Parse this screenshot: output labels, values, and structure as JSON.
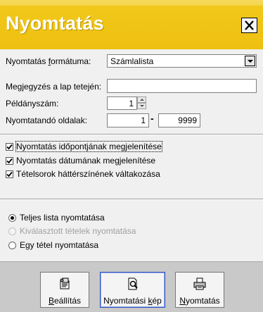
{
  "dialog": {
    "title": "Nyomtatás"
  },
  "form": {
    "format_label_pre": "Nyomtatás ",
    "format_label_u": "f",
    "format_label_post": "ormátuma:",
    "format_value": "Számlalista",
    "note_label": "Megjegyzés a lap tetején:",
    "note_value": "",
    "copies_label": "Példányszám:",
    "copies_value": "1",
    "pages_label": "Nyomtatandó oldalak:",
    "pages_from": "1",
    "pages_dash": "-",
    "pages_to": "9999"
  },
  "options": [
    {
      "label": "Nyomtatás időpontjának megjelenítése",
      "checked": true
    },
    {
      "label": "Nyomtatás dátumának megjelenítése",
      "checked": true
    },
    {
      "label": "Tételsorok háttérszínének váltakozása",
      "checked": true
    }
  ],
  "scope": [
    {
      "label": "Teljes lista nyomtatása",
      "selected": true,
      "enabled": true
    },
    {
      "label": "Kiválasztott tételek nyomtatása",
      "selected": false,
      "enabled": false
    },
    {
      "label": "Egy tétel nyomtatása",
      "selected": false,
      "enabled": true
    }
  ],
  "buttons": {
    "settings_u": "B",
    "settings_rest": "eállítás",
    "preview_pre": "Nyomtatási ",
    "preview_u": "k",
    "preview_post": "ép",
    "print_u": "N",
    "print_rest": "yomtatás"
  },
  "colors": {
    "header": "#eec010",
    "default_button_border": "#2a4fbf"
  }
}
